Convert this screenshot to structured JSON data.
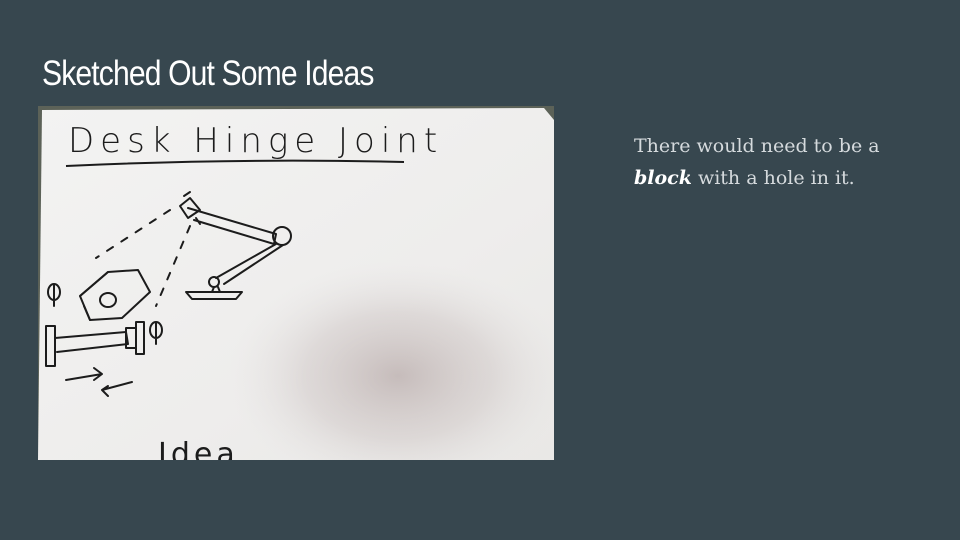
{
  "slide": {
    "title": "Sketched Out Some Ideas",
    "body_before": "There would need to be a ",
    "body_emphasis": "block",
    "body_after": " with a hole in it."
  },
  "sketch": {
    "heading": "Desk Hinge Joint",
    "footer": "Idea"
  },
  "colors": {
    "background": "#37474f",
    "title": "#ffffff",
    "body_text": "#d5dadd",
    "paper": "#eeedeb",
    "ink": "#1c1c1c"
  }
}
